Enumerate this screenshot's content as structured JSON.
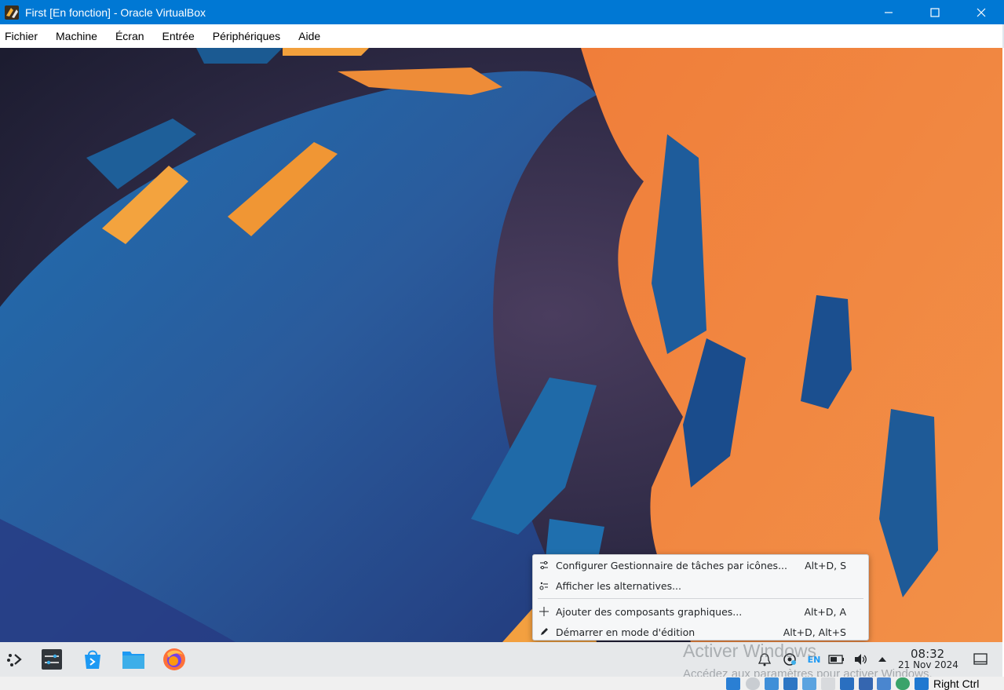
{
  "window": {
    "title": "First [En fonction] - Oracle VirtualBox"
  },
  "menubar": {
    "items": [
      "Fichier",
      "Machine",
      "Écran",
      "Entrée",
      "Périphériques",
      "Aide"
    ]
  },
  "context_menu": {
    "items": [
      {
        "label": "Configurer Gestionnaire de tâches par icônes...",
        "shortcut": "Alt+D, S",
        "icon": "configure-icon"
      },
      {
        "label": "Afficher les alternatives...",
        "shortcut": "",
        "icon": "alternatives-icon"
      },
      {
        "label": "Ajouter des composants graphiques...",
        "shortcut": "Alt+D, A",
        "icon": "add-icon"
      },
      {
        "label": "Démarrer en mode d'édition",
        "shortcut": "Alt+D, Alt+S",
        "icon": "edit-icon"
      }
    ]
  },
  "panel": {
    "launchers": [
      "application-launcher-icon",
      "system-settings-icon",
      "discover-store-icon",
      "file-manager-icon",
      "firefox-icon"
    ],
    "tray": {
      "keyboard_layout": "EN",
      "icons": [
        "notifications-icon",
        "network-icon",
        "keyboard-layout-icon",
        "battery-icon",
        "volume-icon",
        "tray-expand-icon",
        "show-desktop-icon"
      ]
    },
    "clock": {
      "time": "08:32",
      "date": "21 Nov 2024"
    }
  },
  "watermark": {
    "line1": "Activer Windows",
    "line2": "Accédez aux paramètres pour activer Windows."
  },
  "statusbar": {
    "host_key": "Right Ctrl",
    "icons": [
      "hard-disk-icon",
      "optical-drive-icon",
      "audio-icon",
      "network-adapter-icon",
      "usb-icon",
      "shared-folders-icon",
      "display-icon",
      "recording-icon",
      "vt-x-icon",
      "mouse-integration-icon",
      "keyboard-capture-icon"
    ]
  },
  "colors": {
    "titlebar": "#0078d4",
    "wallpaper_blue": "#1f6fb4",
    "wallpaper_orange": "#f08a3c",
    "wallpaper_dark": "#2b2a45",
    "panel": "#e6e8ea"
  }
}
